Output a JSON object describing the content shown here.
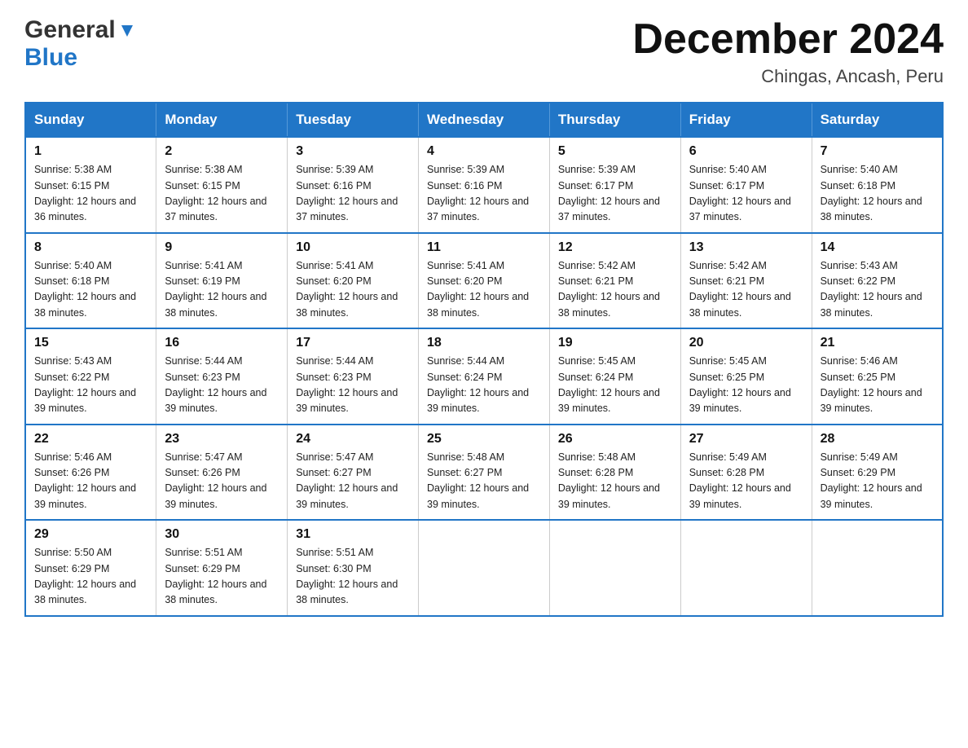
{
  "header": {
    "logo_general": "General",
    "logo_blue": "Blue",
    "title": "December 2024",
    "subtitle": "Chingas, Ancash, Peru"
  },
  "days_of_week": [
    "Sunday",
    "Monday",
    "Tuesday",
    "Wednesday",
    "Thursday",
    "Friday",
    "Saturday"
  ],
  "weeks": [
    [
      {
        "day": "1",
        "sunrise": "5:38 AM",
        "sunset": "6:15 PM",
        "daylight": "12 hours and 36 minutes."
      },
      {
        "day": "2",
        "sunrise": "5:38 AM",
        "sunset": "6:15 PM",
        "daylight": "12 hours and 37 minutes."
      },
      {
        "day": "3",
        "sunrise": "5:39 AM",
        "sunset": "6:16 PM",
        "daylight": "12 hours and 37 minutes."
      },
      {
        "day": "4",
        "sunrise": "5:39 AM",
        "sunset": "6:16 PM",
        "daylight": "12 hours and 37 minutes."
      },
      {
        "day": "5",
        "sunrise": "5:39 AM",
        "sunset": "6:17 PM",
        "daylight": "12 hours and 37 minutes."
      },
      {
        "day": "6",
        "sunrise": "5:40 AM",
        "sunset": "6:17 PM",
        "daylight": "12 hours and 37 minutes."
      },
      {
        "day": "7",
        "sunrise": "5:40 AM",
        "sunset": "6:18 PM",
        "daylight": "12 hours and 38 minutes."
      }
    ],
    [
      {
        "day": "8",
        "sunrise": "5:40 AM",
        "sunset": "6:18 PM",
        "daylight": "12 hours and 38 minutes."
      },
      {
        "day": "9",
        "sunrise": "5:41 AM",
        "sunset": "6:19 PM",
        "daylight": "12 hours and 38 minutes."
      },
      {
        "day": "10",
        "sunrise": "5:41 AM",
        "sunset": "6:20 PM",
        "daylight": "12 hours and 38 minutes."
      },
      {
        "day": "11",
        "sunrise": "5:41 AM",
        "sunset": "6:20 PM",
        "daylight": "12 hours and 38 minutes."
      },
      {
        "day": "12",
        "sunrise": "5:42 AM",
        "sunset": "6:21 PM",
        "daylight": "12 hours and 38 minutes."
      },
      {
        "day": "13",
        "sunrise": "5:42 AM",
        "sunset": "6:21 PM",
        "daylight": "12 hours and 38 minutes."
      },
      {
        "day": "14",
        "sunrise": "5:43 AM",
        "sunset": "6:22 PM",
        "daylight": "12 hours and 38 minutes."
      }
    ],
    [
      {
        "day": "15",
        "sunrise": "5:43 AM",
        "sunset": "6:22 PM",
        "daylight": "12 hours and 39 minutes."
      },
      {
        "day": "16",
        "sunrise": "5:44 AM",
        "sunset": "6:23 PM",
        "daylight": "12 hours and 39 minutes."
      },
      {
        "day": "17",
        "sunrise": "5:44 AM",
        "sunset": "6:23 PM",
        "daylight": "12 hours and 39 minutes."
      },
      {
        "day": "18",
        "sunrise": "5:44 AM",
        "sunset": "6:24 PM",
        "daylight": "12 hours and 39 minutes."
      },
      {
        "day": "19",
        "sunrise": "5:45 AM",
        "sunset": "6:24 PM",
        "daylight": "12 hours and 39 minutes."
      },
      {
        "day": "20",
        "sunrise": "5:45 AM",
        "sunset": "6:25 PM",
        "daylight": "12 hours and 39 minutes."
      },
      {
        "day": "21",
        "sunrise": "5:46 AM",
        "sunset": "6:25 PM",
        "daylight": "12 hours and 39 minutes."
      }
    ],
    [
      {
        "day": "22",
        "sunrise": "5:46 AM",
        "sunset": "6:26 PM",
        "daylight": "12 hours and 39 minutes."
      },
      {
        "day": "23",
        "sunrise": "5:47 AM",
        "sunset": "6:26 PM",
        "daylight": "12 hours and 39 minutes."
      },
      {
        "day": "24",
        "sunrise": "5:47 AM",
        "sunset": "6:27 PM",
        "daylight": "12 hours and 39 minutes."
      },
      {
        "day": "25",
        "sunrise": "5:48 AM",
        "sunset": "6:27 PM",
        "daylight": "12 hours and 39 minutes."
      },
      {
        "day": "26",
        "sunrise": "5:48 AM",
        "sunset": "6:28 PM",
        "daylight": "12 hours and 39 minutes."
      },
      {
        "day": "27",
        "sunrise": "5:49 AM",
        "sunset": "6:28 PM",
        "daylight": "12 hours and 39 minutes."
      },
      {
        "day": "28",
        "sunrise": "5:49 AM",
        "sunset": "6:29 PM",
        "daylight": "12 hours and 39 minutes."
      }
    ],
    [
      {
        "day": "29",
        "sunrise": "5:50 AM",
        "sunset": "6:29 PM",
        "daylight": "12 hours and 38 minutes."
      },
      {
        "day": "30",
        "sunrise": "5:51 AM",
        "sunset": "6:29 PM",
        "daylight": "12 hours and 38 minutes."
      },
      {
        "day": "31",
        "sunrise": "5:51 AM",
        "sunset": "6:30 PM",
        "daylight": "12 hours and 38 minutes."
      },
      null,
      null,
      null,
      null
    ]
  ]
}
